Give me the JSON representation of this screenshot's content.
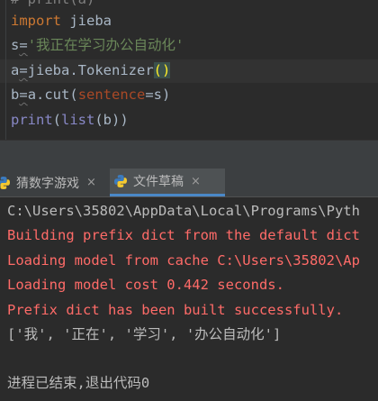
{
  "editor": {
    "partial_line": "# print(a)",
    "line1": {
      "kw": "import",
      "rest": " jieba"
    },
    "line2": {
      "var": "s",
      "op": "=",
      "str": "'我正在学习办公自动化'"
    },
    "line3": {
      "var": "a",
      "op": "=",
      "call": "jieba.Tokenizer",
      "paren": "()"
    },
    "line4": {
      "var": "b",
      "op": "=",
      "pre": "a.cut(",
      "param": "sentence",
      "post": "=s)"
    },
    "line5": {
      "fn": "print",
      "open": "(",
      "builtin": "list",
      "rest": "(b))"
    }
  },
  "tabs": [
    {
      "label": "猜数字游戏",
      "close": "×",
      "icon": "python-icon"
    },
    {
      "label": "文件草稿",
      "close": "×",
      "icon": "python-icon"
    }
  ],
  "console": {
    "lines": [
      "C:\\Users\\35802\\AppData\\Local\\Programs\\Pyth",
      "Building prefix dict from the default dict",
      "Loading model from cache C:\\Users\\35802\\Ap",
      "Loading model cost 0.442 seconds.",
      "Prefix dict has been built successfully.",
      "['我', '正在', '学习', '办公自动化']",
      "进程已结束,退出代码0"
    ]
  },
  "colors": {
    "background": "#2b2b2b",
    "keyword": "#cc7832",
    "string": "#6a8759",
    "error_text": "#ff6b68",
    "tab_bar": "#3c3f41",
    "active_tab_underline": "#4a88c7"
  }
}
